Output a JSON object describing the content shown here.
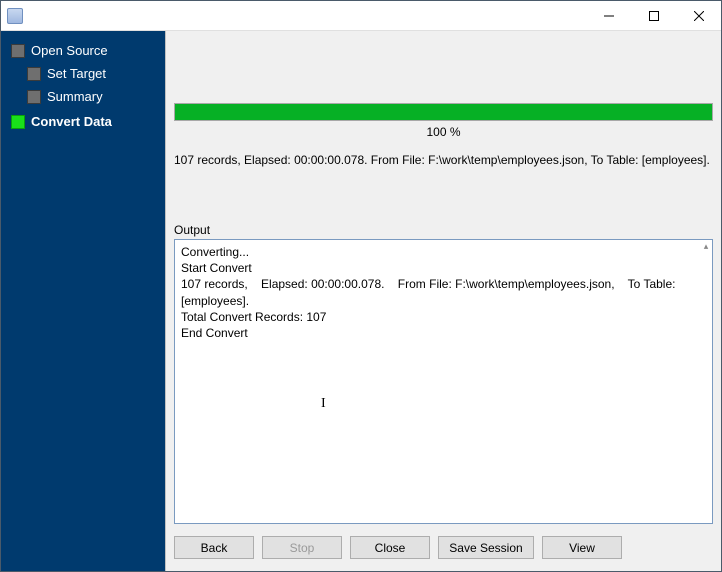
{
  "window": {
    "title": ""
  },
  "sidebar": {
    "root": {
      "label": "Open Source"
    },
    "items": [
      {
        "label": "Set Target",
        "active": false
      },
      {
        "label": "Summary",
        "active": false
      },
      {
        "label": "Convert Data",
        "active": true
      }
    ]
  },
  "progress": {
    "percent_label": "100 %",
    "percent_value": 100
  },
  "status": {
    "line": "107 records,    Elapsed: 00:00:00.078.    From File: F:\\work\\temp\\employees.json,    To Table: [employees]."
  },
  "output": {
    "label": "Output",
    "text": "Converting...\nStart Convert\n107 records,    Elapsed: 00:00:00.078.    From File: F:\\work\\temp\\employees.json,    To Table: [employees].\nTotal Convert Records: 107\nEnd Convert"
  },
  "buttons": {
    "back": "Back",
    "stop": "Stop",
    "close": "Close",
    "save_session": "Save Session",
    "view": "View"
  }
}
